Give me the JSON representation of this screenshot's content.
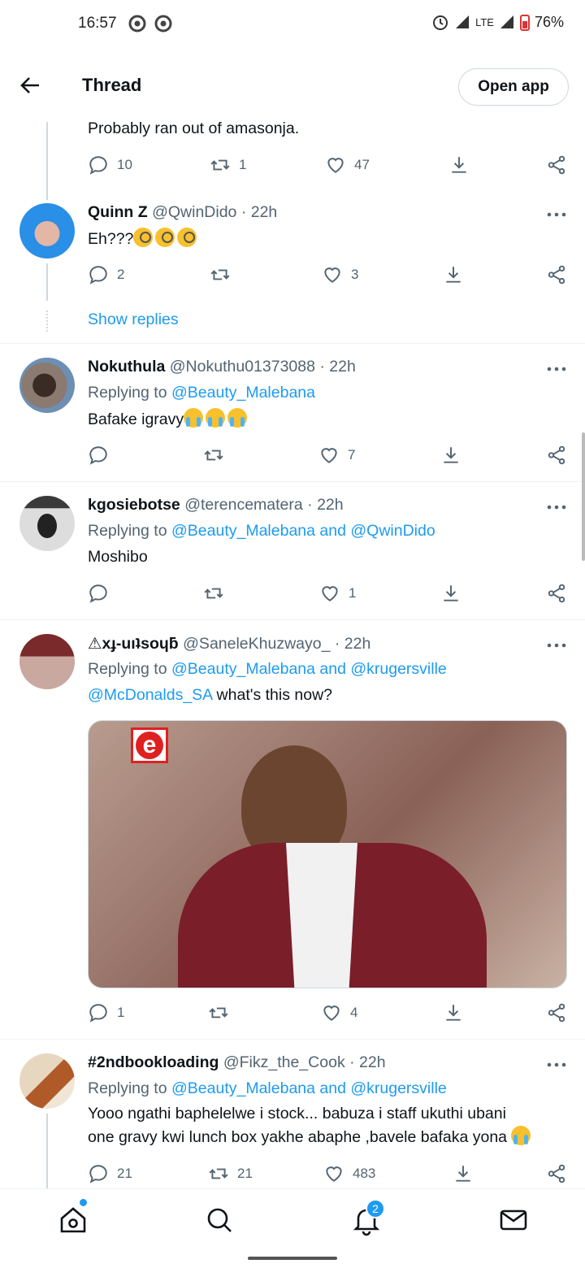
{
  "status_bar": {
    "time": "16:57",
    "network": "LTE",
    "battery": "76%"
  },
  "header": {
    "title": "Thread",
    "open_app": "Open app"
  },
  "tweets": [
    {
      "text": "Probably ran out of amasonja.",
      "reply_count": "10",
      "retweet_count": "1",
      "like_count": "47"
    },
    {
      "name": "Quinn Z",
      "handle": "@QwinDido",
      "time": "· 22h",
      "text": "Eh???",
      "reply_count": "2",
      "retweet_count": "",
      "like_count": "3",
      "show_replies": "Show replies"
    },
    {
      "name": "Nokuthula",
      "handle": "@Nokuthu01373088",
      "time": "· 22h",
      "replying_prefix": "Replying to",
      "replying_to": "@Beauty_Malebana",
      "text": "Bafake igravy",
      "reply_count": "",
      "retweet_count": "",
      "like_count": "7"
    },
    {
      "name": "kgosiebotse",
      "handle": "@terencematera",
      "time": "· 22h",
      "replying_prefix": "Replying to",
      "replying_to": "@Beauty_Malebana and @QwinDido",
      "text": "Moshibo",
      "reply_count": "",
      "retweet_count": "",
      "like_count": "1"
    },
    {
      "name": "⚠xɟ-uıʇsoɥƃ",
      "handle": "@SaneleKhuzwayo_",
      "time": "· 22h",
      "replying_prefix": "Replying to",
      "replying_to": "@Beauty_Malebana and @krugersville",
      "mention": "@McDonalds_SA",
      "text": "what's this now?",
      "media_logo": "e",
      "reply_count": "1",
      "retweet_count": "",
      "like_count": "4"
    },
    {
      "name": "#2ndbookloading",
      "handle": "@Fikz_the_Cook",
      "time": "· 22h",
      "replying_prefix": "Replying to",
      "replying_to": "@Beauty_Malebana and @krugersville",
      "text_line1": "Yooo ngathi baphelelwe  i stock... babuza i staff ukuthi ubani",
      "text_line2": "one gravy  kwi lunch box  yakhe abaphe ,bavele bafaka yona",
      "reply_count": "21",
      "retweet_count": "21",
      "like_count": "483"
    }
  ],
  "bottom_nav": {
    "notifications_badge": "2"
  },
  "colors": {
    "accent": "#1d9bf0",
    "secondary_text": "#536471",
    "primary_text": "#0f1419"
  }
}
